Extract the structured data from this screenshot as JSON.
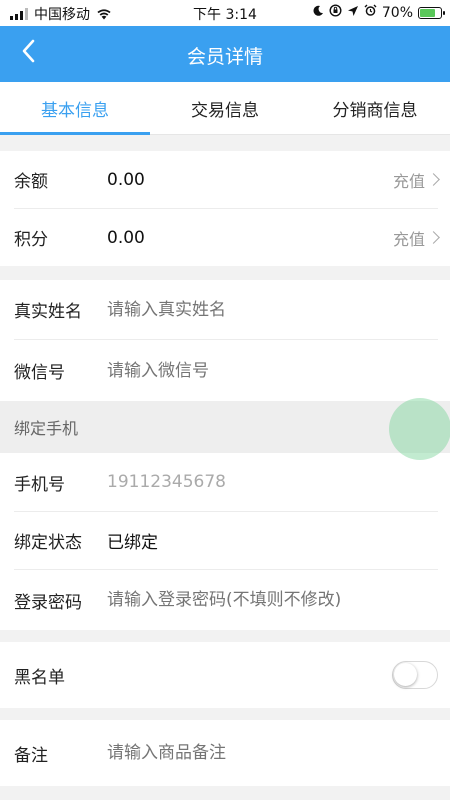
{
  "status_bar": {
    "carrier": "中国移动",
    "time": "下午 3:14",
    "battery": "70%",
    "battery_level": 0.7,
    "icons": [
      "signal-icon",
      "wifi-icon",
      "moon-icon",
      "orientation-lock-icon",
      "location-icon",
      "alarm-icon",
      "battery-icon"
    ]
  },
  "nav": {
    "title": "会员详情",
    "back_icon": "chevron-left-icon"
  },
  "tabs": [
    {
      "label": "基本信息",
      "active": true
    },
    {
      "label": "交易信息",
      "active": false
    },
    {
      "label": "分销商信息",
      "active": false
    }
  ],
  "balance": {
    "label": "余额",
    "value": "0.00",
    "action": "充值"
  },
  "points": {
    "label": "积分",
    "value": "0.00",
    "action": "充值"
  },
  "realname": {
    "label": "真实姓名",
    "placeholder": "请输入真实姓名"
  },
  "wechat": {
    "label": "微信号",
    "placeholder": "请输入微信号"
  },
  "bind_section": {
    "title": "绑定手机"
  },
  "phone": {
    "label": "手机号",
    "value": "19112345678"
  },
  "bind_status": {
    "label": "绑定状态",
    "value": "已绑定"
  },
  "password": {
    "label": "登录密码",
    "placeholder": "请输入登录密码(不填则不修改)"
  },
  "blacklist": {
    "label": "黑名单",
    "enabled": false
  },
  "remark": {
    "label": "备注",
    "placeholder": "请输入商品备注"
  },
  "colors": {
    "accent": "#3aa0f0",
    "battery_fill": "#5ac85a"
  }
}
